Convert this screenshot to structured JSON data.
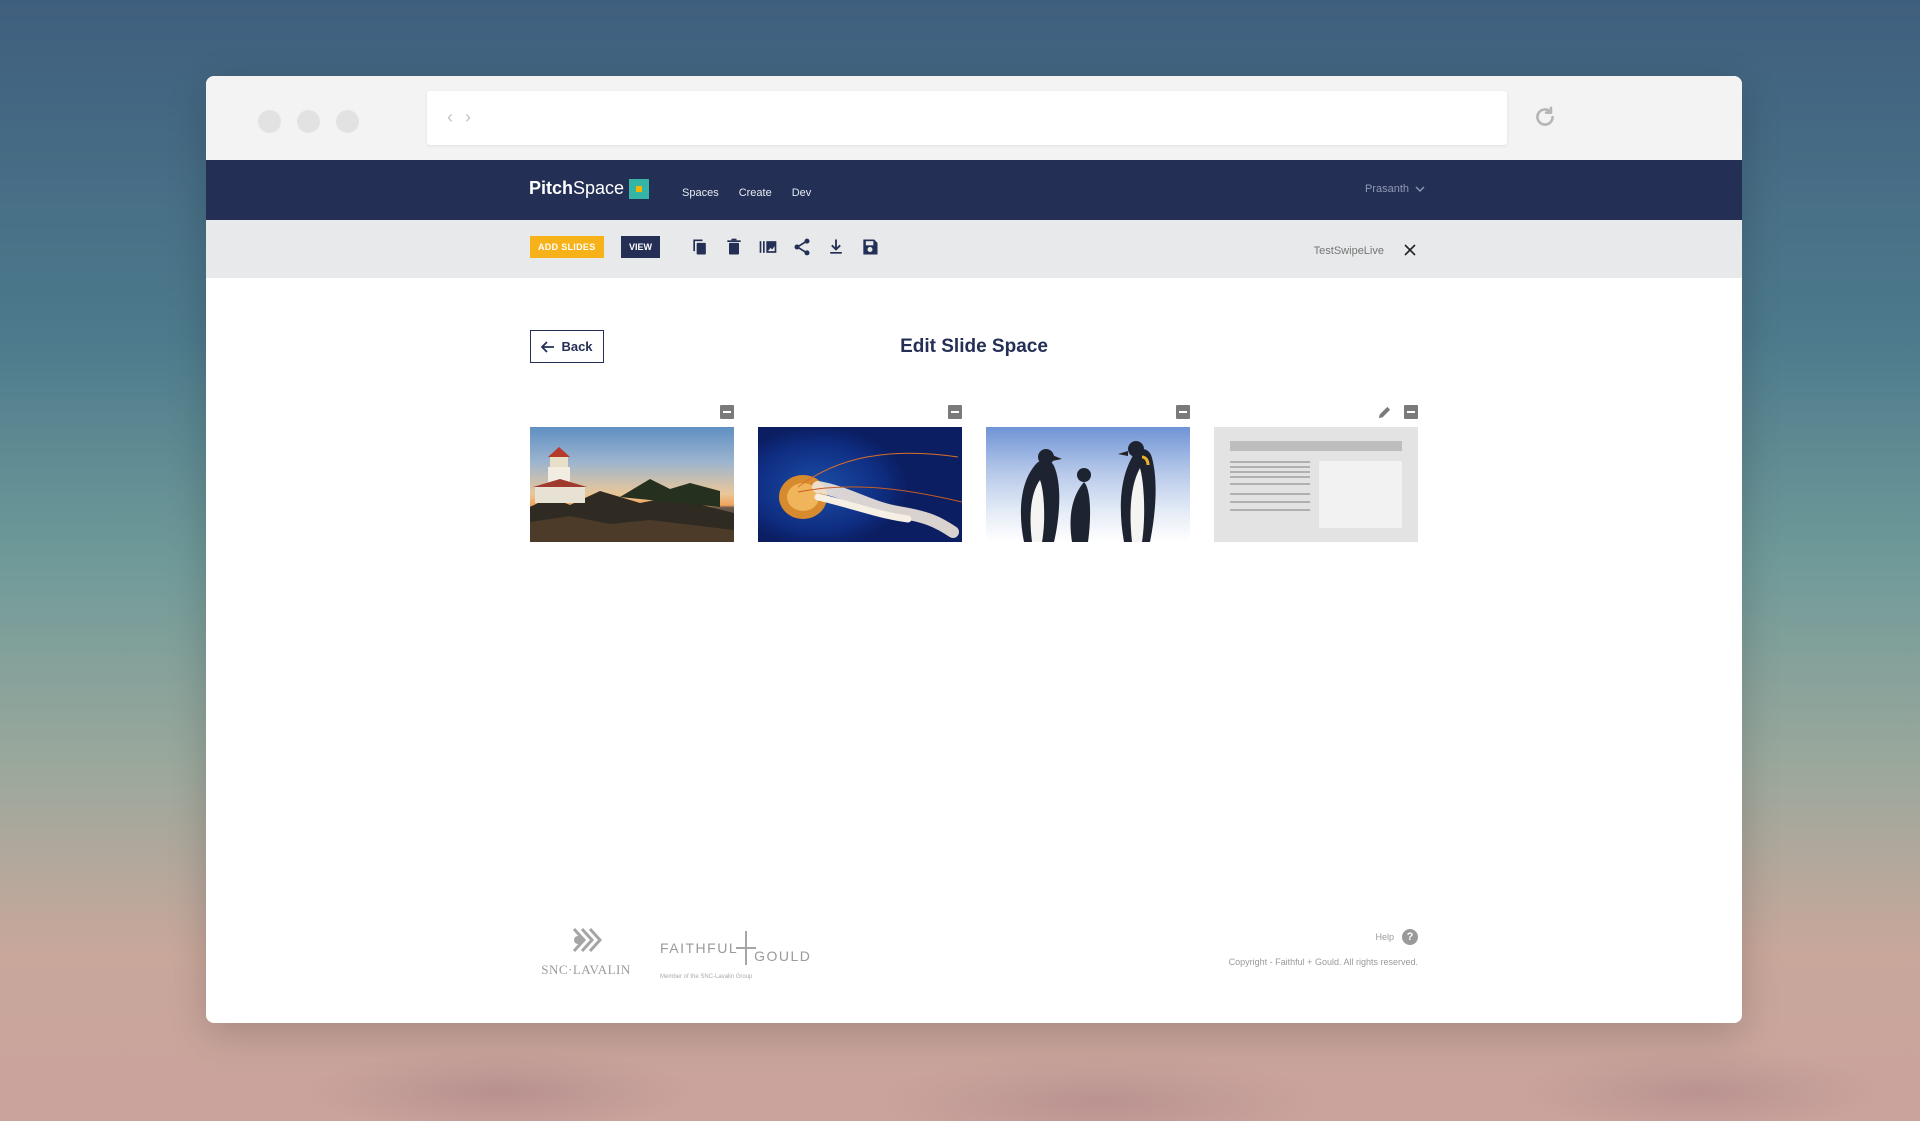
{
  "browser": {
    "back_glyph": "‹",
    "forward_glyph": "›"
  },
  "app": {
    "brand_bold": "Pitch",
    "brand_regular": "Space",
    "menu": [
      "Spaces",
      "Create",
      "Dev"
    ],
    "user_name": "Prasanth",
    "colors": {
      "nav_bg": "#232f55",
      "accent_yellow": "#f7b21a",
      "accent_teal": "#34b5a6"
    }
  },
  "toolbar": {
    "add_slides_label": "ADD SLIDES",
    "view_label": "VIEW",
    "tools": [
      "copy-icon",
      "trash-icon",
      "gallery-icon",
      "share-icon",
      "download-icon",
      "save-icon"
    ],
    "space_name": "TestSwipeLive"
  },
  "page": {
    "back_label": "Back",
    "title": "Edit Slide Space"
  },
  "slides": [
    {
      "image": "lighthouse",
      "editable": false
    },
    {
      "image": "jellyfish",
      "editable": false
    },
    {
      "image": "penguins",
      "editable": false
    },
    {
      "image": "document-layout",
      "editable": true
    }
  ],
  "footer": {
    "snc_logo": "SNC·LAVALIN",
    "fg_logo_left": "FAITHFUL",
    "fg_logo_right": "GOULD",
    "fg_tagline": "Member of the SNC-Lavalin Group",
    "help_label": "Help",
    "help_glyph": "?",
    "copyright": "Copyright - Faithful + Gould. All rights reserved."
  }
}
